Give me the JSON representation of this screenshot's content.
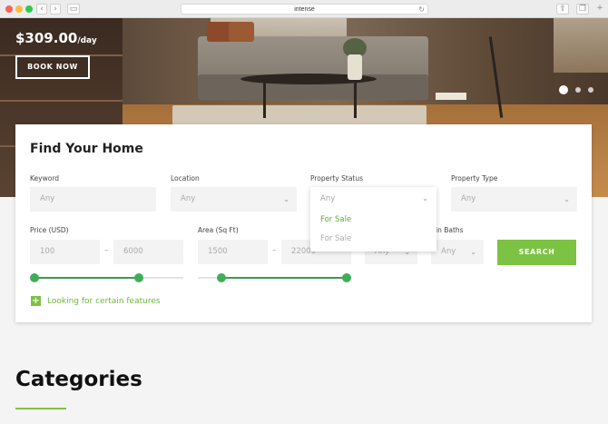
{
  "browser": {
    "url": "intense",
    "back_icon": "chevron-left-icon",
    "forward_icon": "chevron-right-icon",
    "reload_icon": "reload-icon",
    "share_icon": "share-icon",
    "tabs_icon": "tabs-icon"
  },
  "hero": {
    "price": "$309.00",
    "per": "/day",
    "book_label": "BOOK NOW",
    "slides_total": 3,
    "slide_active": 1
  },
  "search": {
    "title": "Find Your Home",
    "keyword": {
      "label": "Keyword",
      "placeholder": "Any"
    },
    "location": {
      "label": "Location",
      "value": "Any"
    },
    "status": {
      "label": "Property Status",
      "value": "Any",
      "options": [
        "For Sale",
        "For Sale"
      ]
    },
    "type": {
      "label": "Property Type",
      "value": "Any"
    },
    "price": {
      "label": "Price (USD)",
      "min": "100",
      "max": "6000",
      "sep": "–"
    },
    "area": {
      "label": "Area (Sq Ft)",
      "min": "1500",
      "max": "22000",
      "sep": "–"
    },
    "beds": {
      "value": "Any"
    },
    "baths": {
      "label": "Min Baths",
      "label_visible": "in Baths",
      "value": "Any"
    },
    "search_label": "SEARCH",
    "features_label": "Looking for certain features"
  },
  "categories": {
    "title": "Categories"
  },
  "colors": {
    "accent": "#7cc243",
    "slider": "#3fae58"
  }
}
